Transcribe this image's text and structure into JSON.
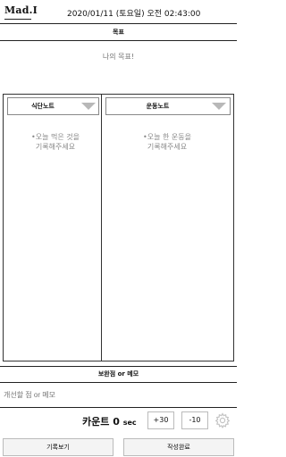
{
  "header": {
    "logo": "Mad.I",
    "datetime": "2020/01/11 (토요일) 오전 02:43:00"
  },
  "goal": {
    "section_title": "목표",
    "text": "나의 목표!"
  },
  "diet_note": {
    "dropdown_label": "식단노트",
    "hint_line1": "•오늘 먹은 것을",
    "hint_line2": "기록해주세요"
  },
  "exercise_note": {
    "dropdown_label": "운동노트",
    "hint_line1": "•오늘 한 운동을",
    "hint_line2": "기록해주세요"
  },
  "feedback": {
    "section_title": "보완점 or 메모",
    "placeholder": "개선할 점 or 메모"
  },
  "counter": {
    "label": "카운트",
    "value": "0",
    "unit": "sec",
    "plus_label": "+30",
    "minus_label": "-10"
  },
  "footer": {
    "view_records_label": "기록보기",
    "complete_label": "작성완료"
  },
  "colors": {
    "caret": "#b8b8b8",
    "hint_text": "#888888",
    "border": "#333333"
  },
  "icons": {
    "settings": "gear-icon",
    "dropdown": "chevron-down-icon"
  }
}
